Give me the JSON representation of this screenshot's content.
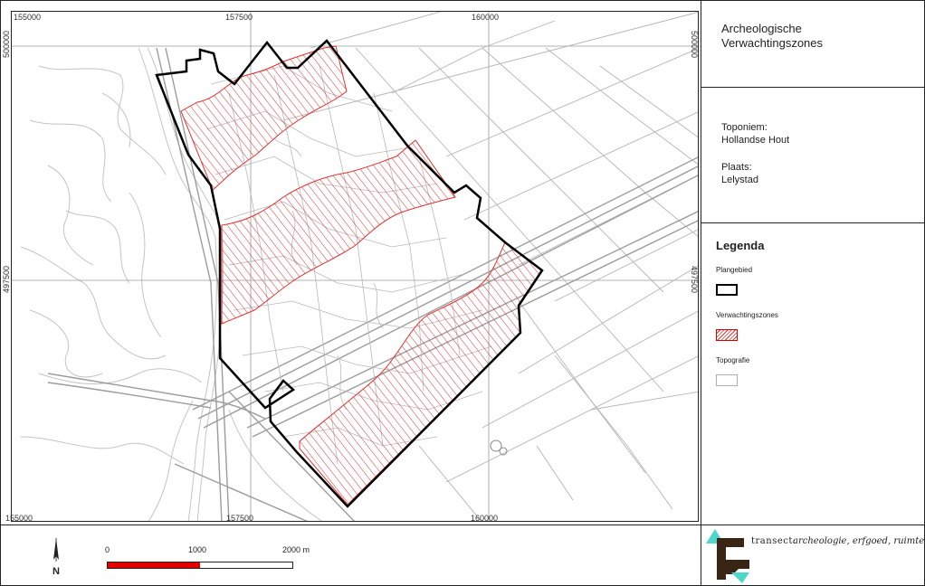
{
  "map": {
    "coords": {
      "x_top": [
        "155000",
        "157500",
        "160000"
      ],
      "x_bottom": [
        "155000",
        "157500",
        "160000"
      ],
      "y_left": [
        "500000",
        "497500"
      ],
      "y_right": [
        "500000",
        "497500"
      ]
    }
  },
  "panel": {
    "title_line1": "Archeologische",
    "title_line2": "Verwachtingszones",
    "toponiem_label": "Toponiem:",
    "toponiem_value": "Hollandse Hout",
    "plaats_label": "Plaats:",
    "plaats_value": "Lelystad"
  },
  "legend": {
    "title": "Legenda",
    "items": [
      {
        "label": "Plangebied",
        "color": "#000000"
      },
      {
        "label": "Verwachtingszones",
        "color": "#e23030"
      },
      {
        "label": "Topografie",
        "color": "#b0b0b0"
      }
    ]
  },
  "scalebar": {
    "labels": [
      "0",
      "1000",
      "2000 m"
    ],
    "colors": [
      "#e00000",
      "#ffffff"
    ]
  },
  "north_arrow": {
    "label": "N",
    "icon": "north-arrow-icon"
  },
  "logo": {
    "brand": "transect:",
    "tagline": "archeologie, erfgoed, ruimte",
    "colors": [
      "#3a2416",
      "#4fd6c8"
    ]
  }
}
